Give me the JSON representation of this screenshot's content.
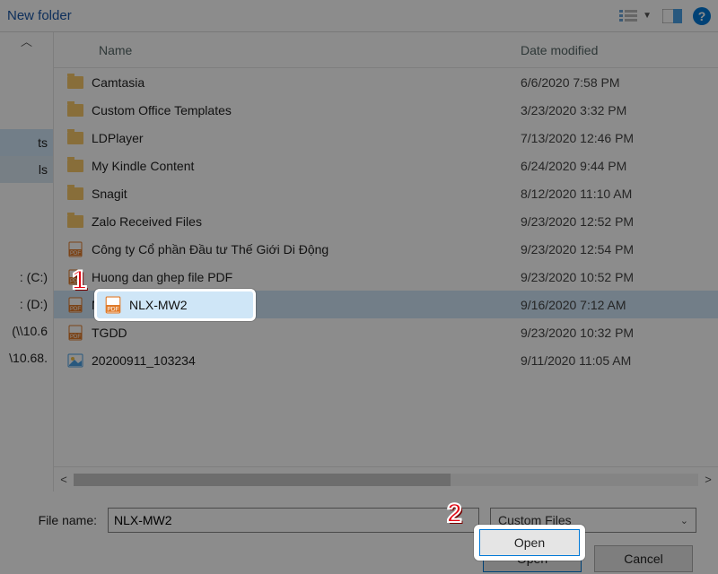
{
  "toolbar": {
    "new_folder": "New folder"
  },
  "columns": {
    "name": "Name",
    "date": "Date modified"
  },
  "left_items": [
    "",
    "",
    "ts",
    "ls",
    "",
    "",
    "",
    ": (C:)",
    ": (D:)",
    "(\\\\10.6",
    "\\10.68."
  ],
  "files": [
    {
      "type": "folder",
      "name": "Camtasia",
      "date": "6/6/2020 7:58 PM"
    },
    {
      "type": "folder",
      "name": "Custom Office Templates",
      "date": "3/23/2020 3:32 PM"
    },
    {
      "type": "folder",
      "name": "LDPlayer",
      "date": "7/13/2020 12:46 PM"
    },
    {
      "type": "folder",
      "name": "My Kindle Content",
      "date": "6/24/2020 9:44 PM"
    },
    {
      "type": "folder",
      "name": "Snagit",
      "date": "8/12/2020 11:10 AM"
    },
    {
      "type": "folder",
      "name": "Zalo Received Files",
      "date": "9/23/2020 12:52 PM"
    },
    {
      "type": "pdf",
      "name": "Công ty Cổ phần Đầu tư Thế Giới Di Động",
      "date": "9/23/2020 12:54 PM"
    },
    {
      "type": "pdf",
      "name": "Huong dan ghep file PDF",
      "date": "9/23/2020 10:52 PM"
    },
    {
      "type": "pdf",
      "name": "NLX-MW2",
      "date": "9/16/2020 7:12 AM",
      "selected": true
    },
    {
      "type": "pdf",
      "name": "TGDD",
      "date": "9/23/2020 10:32 PM"
    },
    {
      "type": "img",
      "name": "20200911_103234",
      "date": "9/11/2020 11:05 AM"
    }
  ],
  "highlight_file": {
    "name": "NLX-MW2"
  },
  "bottom": {
    "file_label": "File name:",
    "file_value": "NLX-MW2",
    "filter": "Custom Files",
    "open": "Open",
    "cancel": "Cancel"
  },
  "callouts": {
    "one": "1",
    "two": "2"
  }
}
